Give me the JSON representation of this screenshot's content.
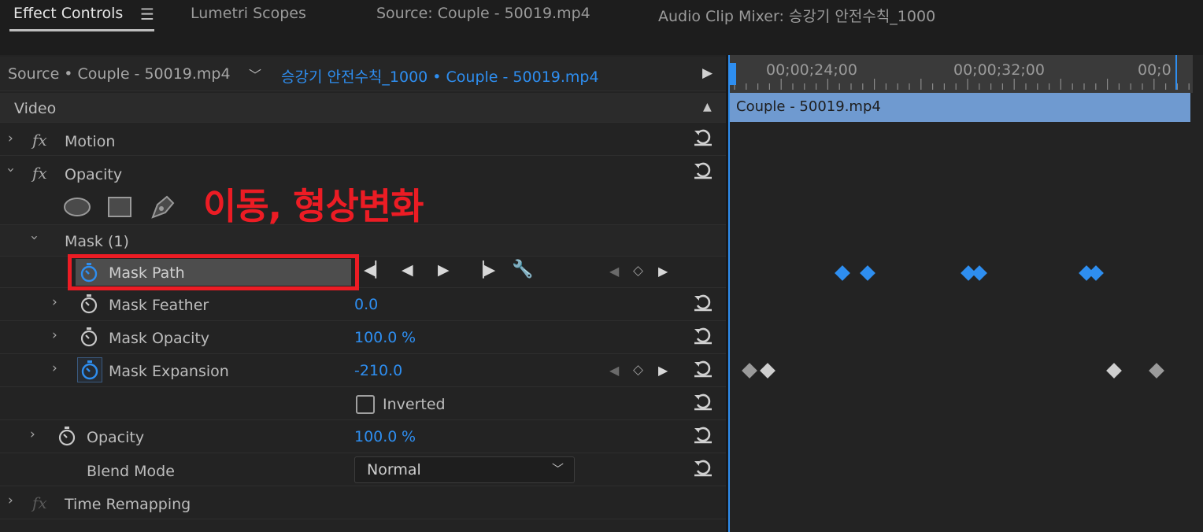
{
  "tabs": [
    {
      "label": "Effect Controls",
      "active": true
    },
    {
      "label": "Lumetri Scopes"
    },
    {
      "label": "Source: Couple - 50019.mp4"
    },
    {
      "label": "Audio Clip Mixer: 승강기 안전수칙_1000"
    }
  ],
  "source_selector": {
    "source_label": "Source • Couple - 50019.mp4",
    "sequence_label": "승강기 안전수칙_1000 • Couple - 50019.mp4"
  },
  "section_video": "Video",
  "effects": {
    "motion": "Motion",
    "opacity": "Opacity",
    "mask": "Mask (1)",
    "mask_path": "Mask Path",
    "mask_feather": {
      "label": "Mask Feather",
      "value": "0.0"
    },
    "mask_opacity": {
      "label": "Mask Opacity",
      "value": "100.0",
      "unit": "%"
    },
    "mask_expansion": {
      "label": "Mask Expansion",
      "value": "-210.0"
    },
    "inverted": "Inverted",
    "opacity_prop": {
      "label": "Opacity",
      "value": "100.0",
      "unit": "%"
    },
    "blend_mode": {
      "label": "Blend Mode",
      "value": "Normal"
    },
    "time_remapping": "Time Remapping"
  },
  "annotation": "이동, 형상변화",
  "timeline": {
    "timecodes": [
      "00;00;24;00",
      "00;00;32;00",
      "00;0"
    ],
    "clip_name": "Couple - 50019.mp4"
  },
  "colors": {
    "accent_blue": "#2e8ef0",
    "annotation_red": "#ec1c24",
    "clip_bar": "#6f9ad0"
  }
}
